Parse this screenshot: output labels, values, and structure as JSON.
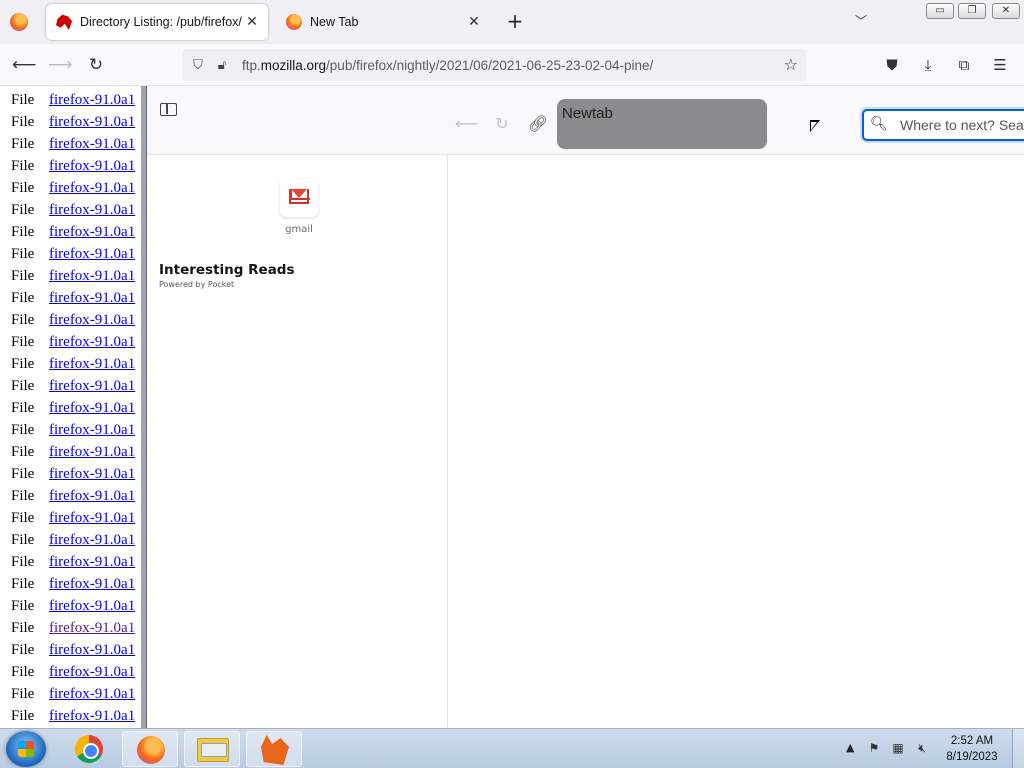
{
  "browser": {
    "tabs": [
      {
        "title": "Directory Listing: /pub/firefox/n",
        "active": true
      },
      {
        "title": "New Tab",
        "active": false
      }
    ],
    "new_tab_symbol": "+",
    "list_all_tabs_symbol": "﹀",
    "window_controls": {
      "minimize": "▭",
      "restore": "❐",
      "close": "✕"
    },
    "url": {
      "prefix": "ftp.",
      "host": "mozilla.org",
      "path": "/pub/firefox/nightly/2021/06/2021-06-25-23-02-04-pine/"
    }
  },
  "listing": {
    "kind_label": "File",
    "rows": [
      {
        "name": "firefox-91.0a1",
        "visited": false
      },
      {
        "name": "firefox-91.0a1",
        "visited": false
      },
      {
        "name": "firefox-91.0a1",
        "visited": false
      },
      {
        "name": "firefox-91.0a1",
        "visited": false
      },
      {
        "name": "firefox-91.0a1",
        "visited": false
      },
      {
        "name": "firefox-91.0a1",
        "visited": false
      },
      {
        "name": "firefox-91.0a1",
        "visited": false
      },
      {
        "name": "firefox-91.0a1",
        "visited": false
      },
      {
        "name": "firefox-91.0a1",
        "visited": false
      },
      {
        "name": "firefox-91.0a1",
        "visited": false
      },
      {
        "name": "firefox-91.0a1",
        "visited": false
      },
      {
        "name": "firefox-91.0a1",
        "visited": false
      },
      {
        "name": "firefox-91.0a1",
        "visited": false
      },
      {
        "name": "firefox-91.0a1",
        "visited": false
      },
      {
        "name": "firefox-91.0a1",
        "visited": false
      },
      {
        "name": "firefox-91.0a1",
        "visited": false
      },
      {
        "name": "firefox-91.0a1",
        "visited": false
      },
      {
        "name": "firefox-91.0a1",
        "visited": false
      },
      {
        "name": "firefox-91.0a1",
        "visited": false
      },
      {
        "name": "firefox-91.0a1",
        "visited": false
      },
      {
        "name": "firefox-91.0a1",
        "visited": false
      },
      {
        "name": "firefox-91.0a1",
        "visited": false
      },
      {
        "name": "firefox-91.0a1",
        "visited": false
      },
      {
        "name": "firefox-91.0a1",
        "visited": false
      },
      {
        "name": "firefox-91.0a1",
        "visited": true
      },
      {
        "name": "firefox-91.0a1",
        "visited": false
      },
      {
        "name": "firefox-91.0a1",
        "visited": false
      },
      {
        "name": "firefox-91.0a1",
        "visited": false
      },
      {
        "name": "firefox-91.0a1",
        "visited": false
      }
    ]
  },
  "newtab": {
    "page_title": "Newtab",
    "search_placeholder": "Where to next? Search or enter address",
    "top_sites": [
      {
        "label": "gmail"
      }
    ],
    "pocket": {
      "title": "Interesting Reads",
      "subtitle": "Powered by Pocket"
    }
  },
  "taskbar": {
    "clock_time": "2:52 AM",
    "clock_date": "8/19/2023",
    "tray_arrow": "▲"
  },
  "colors": {
    "link": "#0000ee",
    "visited_link": "#551a8b",
    "focus_ring": "#0060df"
  }
}
